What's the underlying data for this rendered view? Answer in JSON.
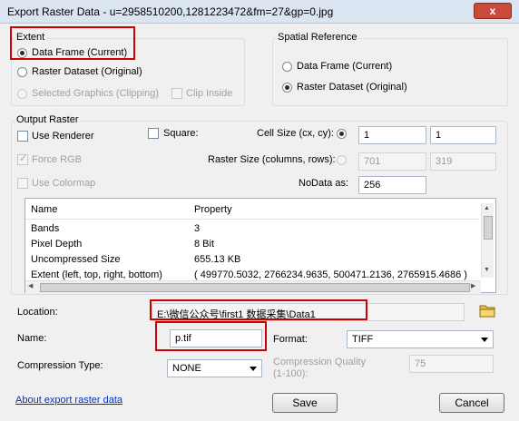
{
  "window": {
    "title": "Export Raster Data - u=2958510200,1281223472&fm=27&gp=0.jpg",
    "close_glyph": "x"
  },
  "extent": {
    "label": "Extent",
    "options": [
      "Data Frame (Current)",
      "Raster Dataset (Original)",
      "Selected Graphics (Clipping)"
    ],
    "selected": "Data Frame (Current)",
    "clip_inside_label": "Clip Inside"
  },
  "spatial_reference": {
    "label": "Spatial Reference",
    "options": [
      "Data Frame (Current)",
      "Raster Dataset (Original)"
    ],
    "selected": "Raster Dataset (Original)"
  },
  "output_raster": {
    "label": "Output Raster",
    "use_renderer": "Use Renderer",
    "force_rgb": "Force RGB",
    "use_colormap": "Use Colormap",
    "square": "Square:",
    "cell_size_label": "Cell Size (cx, cy):",
    "cell_size_cx": "1",
    "cell_size_cy": "1",
    "raster_size_label": "Raster Size (columns, rows):",
    "raster_cols": "701",
    "raster_rows": "319",
    "nodata_label": "NoData as:",
    "nodata_value": "256"
  },
  "properties": {
    "headers": [
      "Name",
      "Property"
    ],
    "rows": [
      [
        "Bands",
        "3"
      ],
      [
        "Pixel Depth",
        "8 Bit"
      ],
      [
        "Uncompressed Size",
        "655.13 KB"
      ],
      [
        "Extent (left, top, right, bottom)",
        "( 499770.5032, 2766234.9635, 500471.2136, 2765915.4686 )"
      ]
    ]
  },
  "location": {
    "label": "Location:",
    "value": "E:\\微信公众号\\first1 数据采集\\Data1"
  },
  "name": {
    "label": "Name:",
    "value": "p.tif"
  },
  "format": {
    "label": "Format:",
    "value": "TIFF"
  },
  "compression_type": {
    "label": "Compression Type:",
    "value": "NONE"
  },
  "compression_quality": {
    "label": "Compression Quality",
    "label2": "(1-100):",
    "value": "75"
  },
  "footer": {
    "about_link": "About export raster data",
    "save": "Save",
    "cancel": "Cancel"
  },
  "colors": {
    "highlight_box": "#cc0000",
    "link": "#0033cc",
    "close_button": "#c94a3b"
  }
}
